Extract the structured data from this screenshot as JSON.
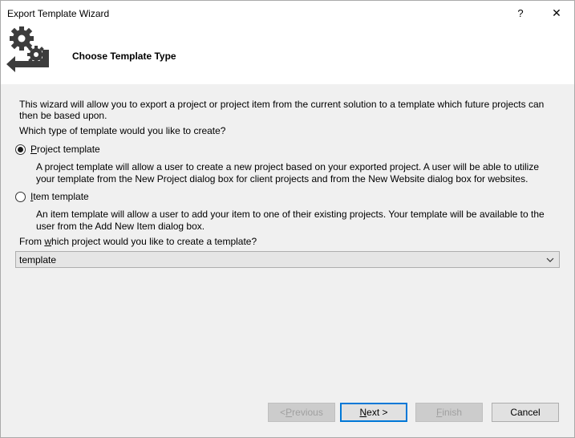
{
  "window": {
    "title": "Export Template Wizard",
    "help_glyph": "?",
    "close_glyph": "✕"
  },
  "header": {
    "title": "Choose Template Type",
    "logo_icon": "gears-arrow-icon"
  },
  "intro": {
    "line1": "This wizard will allow you to export a project or project item from the current solution to a template which future projects can",
    "line2": "then be based upon.",
    "question": "Which type of template would you like to create?"
  },
  "options": [
    {
      "access_key": "P",
      "label_rest": "roject template",
      "selected": true,
      "desc_line1": "A project template will allow a user to create a new project based on your exported project. A user will be able to utilize",
      "desc_line2": "your template from the New Project dialog box for client projects and from the New Website dialog box for websites."
    },
    {
      "access_key": "I",
      "label_rest": "tem template",
      "selected": false,
      "desc_line1": "An item template will allow a user to add your item to one of their existing projects. Your template will be available to the",
      "desc_line2": "user from the Add New Item dialog box."
    }
  ],
  "project_select": {
    "label_pre": "From ",
    "label_key": "w",
    "label_post": "hich project would you like to create a template?",
    "value": "template"
  },
  "buttons": {
    "previous": {
      "pre": "< ",
      "key": "P",
      "post": "revious",
      "enabled": false
    },
    "next": {
      "pre": "",
      "key": "N",
      "post": "ext >",
      "enabled": true
    },
    "finish": {
      "pre": "",
      "key": "F",
      "post": "inish",
      "enabled": false
    },
    "cancel": {
      "label": "Cancel",
      "enabled": true
    }
  },
  "colors": {
    "accent": "#0078d7",
    "dialog_bg": "#f0f0f0",
    "header_bg": "#ffffff",
    "disabled_text": "#a0a0a0",
    "logo_dark": "#3c3c3c"
  }
}
